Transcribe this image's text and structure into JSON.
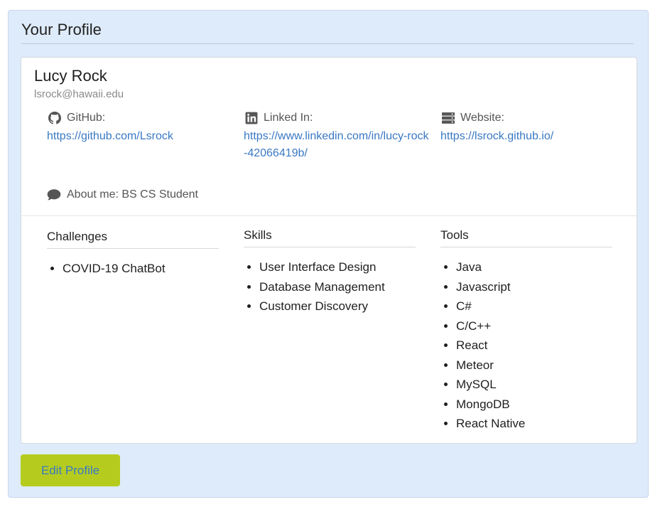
{
  "panel": {
    "title": "Your Profile"
  },
  "profile": {
    "name": "Lucy Rock",
    "email": "lsrock@hawaii.edu",
    "links": [
      {
        "icon": "github-icon",
        "label": "GitHub:",
        "url": "https://github.com/Lsrock"
      },
      {
        "icon": "linkedin-icon",
        "label": "Linked In:",
        "url": "https://www.linkedin.com/in/lucy-rock-42066419b/"
      },
      {
        "icon": "server-icon",
        "label": "Website:",
        "url": "https://lsrock.github.io/"
      }
    ],
    "about": {
      "icon": "comment-icon",
      "text": "About me: BS CS Student"
    }
  },
  "sections": {
    "challenges": {
      "title": "Challenges",
      "items": [
        "COVID-19 ChatBot"
      ]
    },
    "skills": {
      "title": "Skills",
      "items": [
        "User Interface Design",
        "Database Management",
        "Customer Discovery"
      ]
    },
    "tools": {
      "title": "Tools",
      "items": [
        "Java",
        "Javascript",
        "C#",
        "C/C++",
        "React",
        "Meteor",
        "MySQL",
        "MongoDB",
        "React Native"
      ]
    }
  },
  "actions": {
    "edit_label": "Edit Profile"
  },
  "colors": {
    "panel_bg": "#deebfb",
    "link": "#3a78c3",
    "button_bg": "#b5cc1f"
  }
}
